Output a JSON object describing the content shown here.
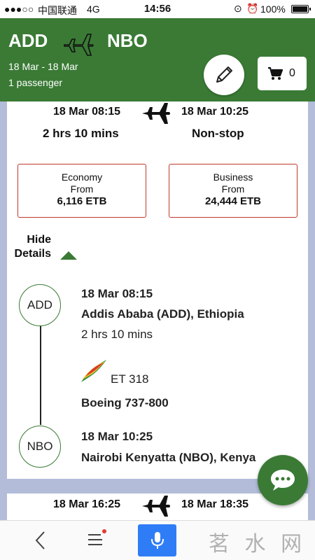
{
  "status_bar": {
    "signal": "●●●○○",
    "carrier": "中国联通",
    "network": "4G",
    "time": "14:56",
    "battery": "100%"
  },
  "header": {
    "origin": "ADD",
    "destination": "NBO",
    "dates": "18 Mar  -  18 Mar",
    "passengers": "1 passenger",
    "cart_count": "0",
    "bg_color": "#3a7a35"
  },
  "flight1": {
    "departure": "18 Mar 08:15",
    "arrival": "18 Mar 10:25",
    "duration": "2 hrs 10 mins",
    "stops": "Non-stop",
    "fares": [
      {
        "cabin": "Economy",
        "from_label": "From",
        "price": "6,116 ETB"
      },
      {
        "cabin": "Business",
        "from_label": "From",
        "price": "24,444 ETB"
      }
    ],
    "hide_details_line1": "Hide",
    "hide_details_line2": "Details",
    "segment": {
      "origin_code": "ADD",
      "origin_time": "18 Mar 08:15",
      "origin_airport": "Addis Ababa (ADD), Ethiopia",
      "duration": "2 hrs 10 mins",
      "flight_number": "ET 318",
      "aircraft": "Boeing 737-800",
      "dest_code": "NBO",
      "dest_time": "18 Mar 10:25",
      "dest_airport": "Nairobi Kenyatta (NBO), Kenya"
    }
  },
  "flight2": {
    "departure": "18 Mar 16:25",
    "arrival": "18 Mar 18:35"
  },
  "watermark": "茗 水 网"
}
